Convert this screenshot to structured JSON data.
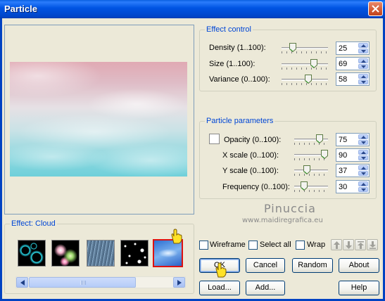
{
  "window": {
    "title": "Particle"
  },
  "preview": {},
  "effect_control": {
    "title": "Effect control",
    "rows": [
      {
        "label": "Density (1..100):",
        "value": "25",
        "pos": 0.24
      },
      {
        "label": "Size (1..100):",
        "value": "69",
        "pos": 0.69
      },
      {
        "label": "Variance (0..100):",
        "value": "58",
        "pos": 0.58
      }
    ]
  },
  "particle_parameters": {
    "title": "Particle parameters",
    "rows": [
      {
        "label": "Opacity (0..100):",
        "value": "75",
        "pos": 0.75
      },
      {
        "label": "X scale (0..100):",
        "value": "90",
        "pos": 0.9
      },
      {
        "label": "Y scale (0..100):",
        "value": "37",
        "pos": 0.37
      },
      {
        "label": "Frequency (0..100):",
        "value": "30",
        "pos": 0.3
      }
    ]
  },
  "effect": {
    "title": "Effect: Cloud",
    "thumbs": [
      "bubbles",
      "sparkle",
      "rain",
      "snow",
      "cloud"
    ],
    "selected": "cloud"
  },
  "watermark": {
    "line1": "Pinuccia",
    "line2": "www.maidiregrafica.eu"
  },
  "options": {
    "wireframe": "Wireframe",
    "select_all": "Select all",
    "wrap": "Wrap"
  },
  "buttons": {
    "ok": "OK",
    "cancel": "Cancel",
    "random": "Random",
    "about": "About",
    "load": "Load...",
    "add": "Add...",
    "help": "Help"
  },
  "colors": {
    "titlebar": "#0054e3",
    "group_title": "#0046d5",
    "selection": "#dd1111"
  },
  "icons": [
    "close-icon",
    "arrow-up-icon",
    "arrow-down-icon",
    "arrow-top-icon",
    "arrow-bottom-icon",
    "hand-pointer-icon"
  ]
}
